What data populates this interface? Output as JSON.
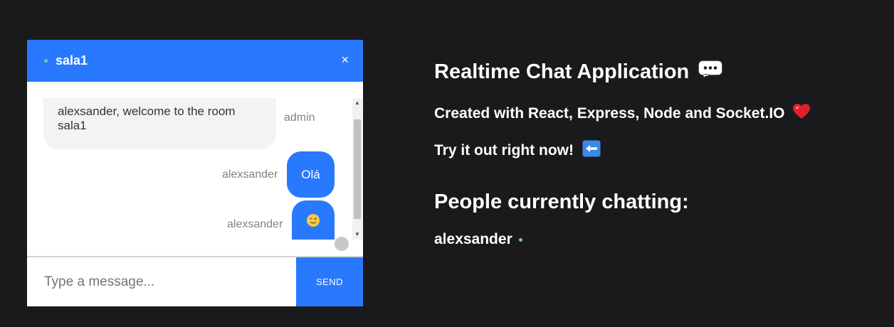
{
  "chat": {
    "room_name": "sala1",
    "close_label": "×",
    "messages": [
      {
        "sender": "admin",
        "text": "alexsander, welcome to the room sala1"
      },
      {
        "sender": "alexsander",
        "text": "Olá"
      },
      {
        "sender": "alexsander",
        "text": "😉"
      }
    ],
    "input_placeholder": "Type a message...",
    "send_label": "SEND"
  },
  "info": {
    "title": "Realtime Chat Application",
    "title_icon": "speech-balloon-icon",
    "subtitle": "Created with React, Express, Node and Socket.IO",
    "subtitle_icon": "heart-icon",
    "cta": "Try it out right now!",
    "cta_icon": "left-arrow-icon",
    "people_heading": "People currently chatting:",
    "users": [
      "alexsander"
    ]
  },
  "colors": {
    "accent": "#2979ff",
    "background": "#1a1a1d",
    "online": "#5fd3a0"
  }
}
